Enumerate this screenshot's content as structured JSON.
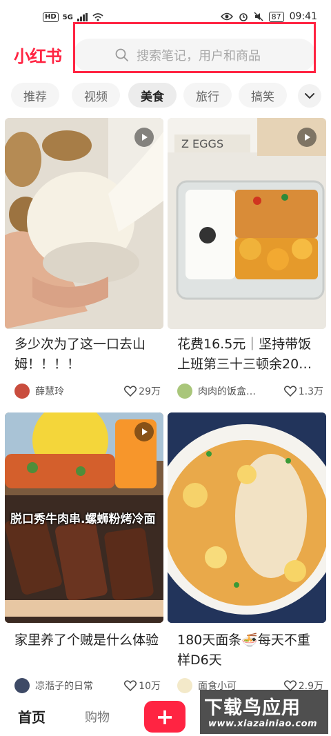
{
  "status_bar": {
    "left": [
      "HD",
      "5G"
    ],
    "battery": "87",
    "time": "09:41"
  },
  "header": {
    "logo": "小红书",
    "search_placeholder": "搜索笔记，用户和商品"
  },
  "tabs": [
    {
      "label": "推荐",
      "active": false
    },
    {
      "label": "视频",
      "active": false
    },
    {
      "label": "美食",
      "active": true
    },
    {
      "label": "旅行",
      "active": false
    },
    {
      "label": "搞笑",
      "active": false
    }
  ],
  "feed": [
    {
      "title": "多少次为了这一口去山姆！！！！",
      "author": "薛慧玲",
      "likes": "29万",
      "is_video": true
    },
    {
      "title": "花费16.5元｜坚持带饭上班第三十三顿余20…",
      "author": "肉肉的饭盒…",
      "likes": "1.3万",
      "is_video": true
    },
    {
      "title": "家里养了个贼是什么体验",
      "author": "凉湉子的日常",
      "likes": "10万",
      "is_video": true,
      "image_caption": "脱口秀牛肉串.螺蛳粉烤冷面"
    },
    {
      "title": "180天面条🍜每天不重样D6天",
      "author": "面食小可",
      "likes": "2.9万",
      "is_video": false
    }
  ],
  "bottom_nav": {
    "home": "首页",
    "shop": "购物",
    "add": "+"
  },
  "watermark": {
    "text": "下载鸟应用",
    "url": "www.xiazainiao.com"
  },
  "colors": {
    "brand": "#ff2442",
    "tab_bg": "#f5f5f5",
    "muted_text": "#a8a8a8"
  }
}
